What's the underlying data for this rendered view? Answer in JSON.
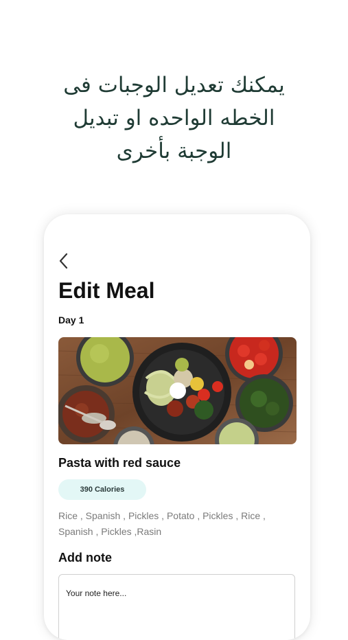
{
  "headline": {
    "line1": "يمكنك تعديل الوجبات فى",
    "line2": "الخطه الواحده او تبديل",
    "line3": "الوجبة بأخرى"
  },
  "screen": {
    "title": "Edit Meal",
    "day_label": "Day 1",
    "meal_name": "Pasta with red sauce",
    "calories": "390 Calories",
    "ingredients": "Rice , Spanish , Pickles , Potato , Pickles , Rice , Spanish , Pickles ,Rasin",
    "add_note_label": "Add note",
    "note_placeholder": "Your note here..."
  },
  "colors": {
    "headline": "#1f3b34",
    "calorie_badge_bg": "#e3f7f6"
  },
  "icons": {
    "back": "chevron-left-icon"
  }
}
